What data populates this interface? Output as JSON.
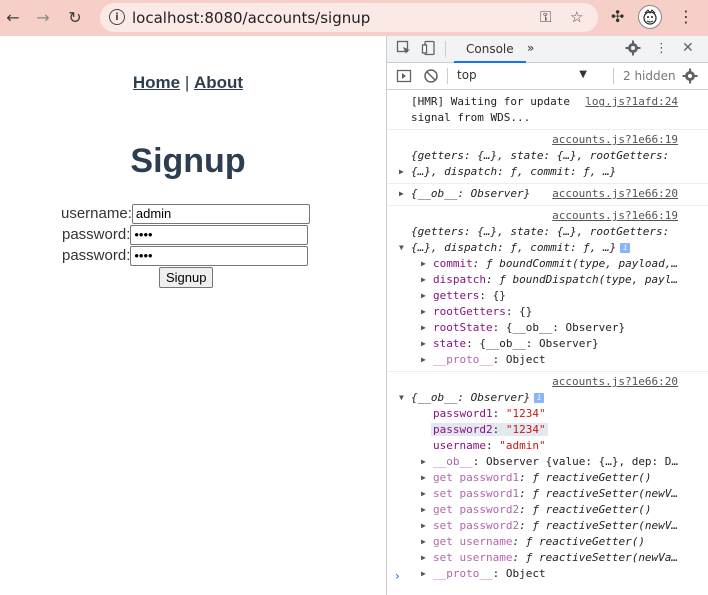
{
  "browser": {
    "url": "localhost:8080/accounts/signup",
    "back_icon": "←",
    "forward_icon": "→",
    "reload_icon": "↻",
    "key_icon": "⚿",
    "star_icon": "☆",
    "puzzle_icon": "✣",
    "menu_icon": "⋮",
    "info_icon": "i"
  },
  "page": {
    "nav": {
      "home": "Home",
      "sep": " | ",
      "about": "About"
    },
    "title": "Signup",
    "form": {
      "username_label": "username:",
      "username_value": "admin",
      "password1_label": "password:",
      "password1_value": "1234",
      "password2_label": "password:",
      "password2_value": "1234",
      "submit": "Signup"
    }
  },
  "devtools": {
    "tab": "Console",
    "more": "»",
    "context": "top",
    "hidden": "2 hidden",
    "messages": [
      {
        "text": "[HMR] Waiting for update",
        "src": "log.js?1afd:24",
        "text2": "signal from WDS..."
      },
      {
        "src": "accounts.js?1e66:19",
        "l1": "{getters: {…}, state: {…}, rootGetters:",
        "l2": "{…}, dispatch: ƒ, commit: ƒ, …}"
      },
      {
        "text": "{__ob__: Observer}",
        "src": "accounts.js?1e66:20"
      },
      {
        "src": "accounts.js?1e66:19",
        "l1": "{getters: {…}, state: {…}, rootGetters:",
        "l2": "{…}, dispatch: ƒ, commit: ƒ, …}",
        "props": [
          {
            "k": "commit",
            "v": ": ƒ boundCommit(type, payload,…"
          },
          {
            "k": "dispatch",
            "v": ": ƒ boundDispatch(type, payl…"
          },
          {
            "k": "getters",
            "v": ": {}"
          },
          {
            "k": "rootGetters",
            "v": ": {}"
          },
          {
            "k": "rootState",
            "v": ": {__ob__: Observer}"
          },
          {
            "k": "state",
            "v": ": {__ob__: Observer}"
          },
          {
            "k": "__proto__",
            "v": ": Object"
          }
        ]
      },
      {
        "src": "accounts.js?1e66:20",
        "head": "{__ob__: Observer}",
        "p1k": "password1",
        "p1v": "\"1234\"",
        "p2k": "password2",
        "p2v": "\"1234\"",
        "p3k": "username",
        "p3v": "\"admin\"",
        "rest": [
          {
            "k": "__ob__",
            "v": ": Observer {value: {…}, dep: D…"
          },
          {
            "k": "get password1",
            "v": ": ƒ reactiveGetter()"
          },
          {
            "k": "set password1",
            "v": ": ƒ reactiveSetter(newV…"
          },
          {
            "k": "get password2",
            "v": ": ƒ reactiveGetter()"
          },
          {
            "k": "set password2",
            "v": ": ƒ reactiveSetter(newV…"
          },
          {
            "k": "get username",
            "v": ": ƒ reactiveGetter()"
          },
          {
            "k": "set username",
            "v": ": ƒ reactiveSetter(newVa…"
          },
          {
            "k": "__proto__",
            "v": ": Object"
          }
        ]
      }
    ],
    "prompt": "›"
  }
}
